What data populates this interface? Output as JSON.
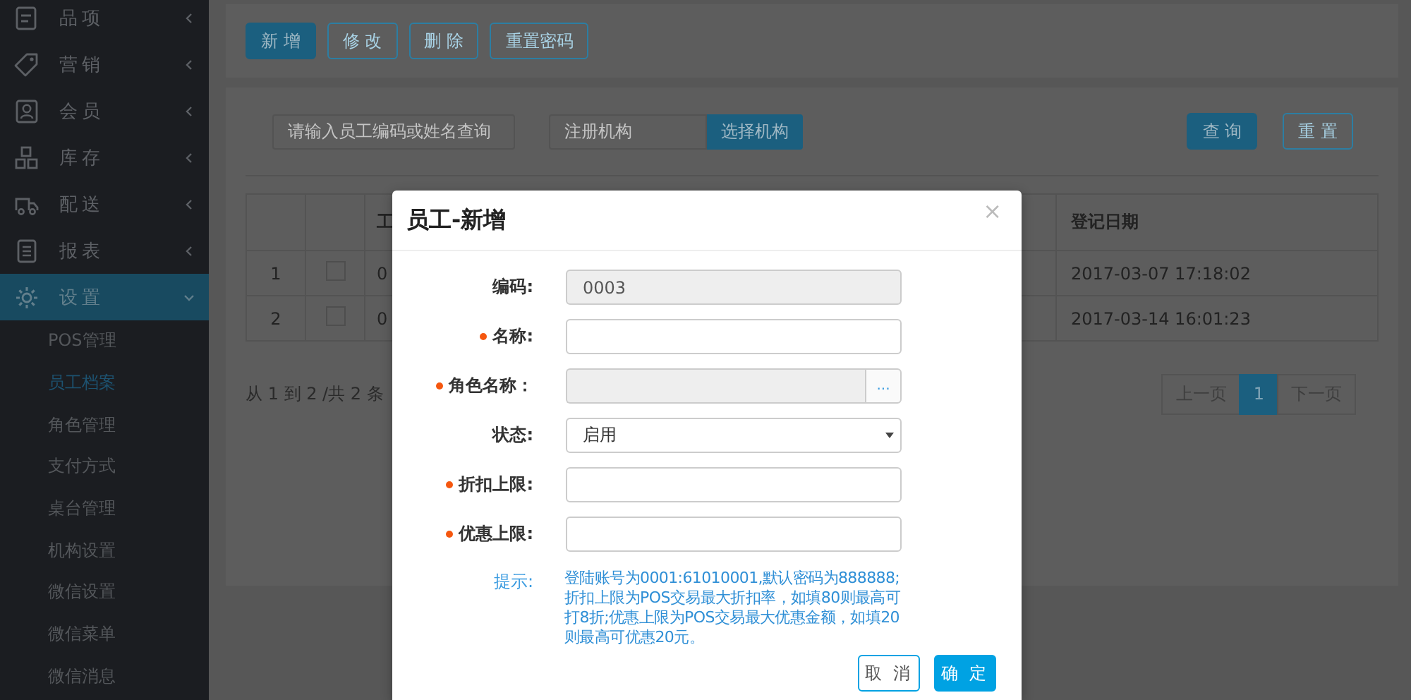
{
  "sidebar": {
    "items": [
      {
        "label": "品项",
        "selected": false,
        "expanded": false
      },
      {
        "label": "营销",
        "selected": false,
        "expanded": false
      },
      {
        "label": "会员",
        "selected": false,
        "expanded": false
      },
      {
        "label": "库存",
        "selected": false,
        "expanded": false
      },
      {
        "label": "配送",
        "selected": false,
        "expanded": false
      },
      {
        "label": "报表",
        "selected": false,
        "expanded": false
      },
      {
        "label": "设置",
        "selected": true,
        "expanded": true,
        "children": [
          {
            "label": "POS管理",
            "selected": false
          },
          {
            "label": "员工档案",
            "selected": true
          },
          {
            "label": "角色管理",
            "selected": false
          },
          {
            "label": "支付方式",
            "selected": false
          },
          {
            "label": "桌台管理",
            "selected": false
          },
          {
            "label": "机构设置",
            "selected": false
          },
          {
            "label": "微信设置",
            "selected": false
          },
          {
            "label": "微信菜单",
            "selected": false
          },
          {
            "label": "微信消息",
            "selected": false
          }
        ]
      }
    ]
  },
  "toolbar": {
    "buttons": [
      {
        "label": "新 增",
        "kind": "primary"
      },
      {
        "label": "修 改",
        "kind": "outline"
      },
      {
        "label": "删 除",
        "kind": "outline"
      },
      {
        "label": "重置密码",
        "kind": "outline"
      }
    ]
  },
  "search": {
    "keyword": {
      "placeholder": "请输入员工编码或姓名查询"
    },
    "organization": {
      "placeholder": "注册机构",
      "button": "选择机构"
    },
    "buttons": [
      {
        "label": "查 询",
        "kind": "primary"
      },
      {
        "label": "重 置",
        "kind": "outline"
      }
    ]
  },
  "table": {
    "columns": [
      "工",
      "登记日期"
    ],
    "rows": [
      {
        "index": "1",
        "checked": false,
        "column_3": "0",
        "date": "2017-03-07 17:18:02"
      },
      {
        "index": "2",
        "checked": false,
        "column_3": "0",
        "date": "2017-03-14 16:01:23"
      }
    ]
  },
  "pagination": {
    "summary": "从 1 到 2 /共 2 条",
    "pages": [
      {
        "label": "上一页",
        "selected": false
      },
      {
        "label": "1",
        "selected": true
      },
      {
        "label": "下一页",
        "selected": false
      }
    ]
  },
  "dialog": {
    "title": "员工-新增",
    "close": "×",
    "fields": [
      {
        "label": "编码:",
        "required": false,
        "kind": "readonly",
        "value": "0003"
      },
      {
        "label": "名称:",
        "required": true,
        "kind": "text"
      },
      {
        "label": "角色名称：",
        "required": true,
        "kind": "picker",
        "button": "..."
      },
      {
        "label": "状态:",
        "required": false,
        "kind": "select",
        "value": "启用"
      },
      {
        "label": "折扣上限:",
        "required": true,
        "kind": "text"
      },
      {
        "label": "优惠上限:",
        "required": true,
        "kind": "text"
      }
    ],
    "hint": {
      "label": "提示:",
      "text": "登陆账号为0001:61010001,默认密码为888888;折扣上限为POS交易最大折扣率，如填80则最高可打8折;优惠上限为POS交易最大优惠金额，如填20则最高可优惠20元。"
    },
    "buttons": [
      {
        "label": "取 消",
        "kind": "outline"
      },
      {
        "label": "确 定",
        "kind": "primary"
      }
    ]
  }
}
